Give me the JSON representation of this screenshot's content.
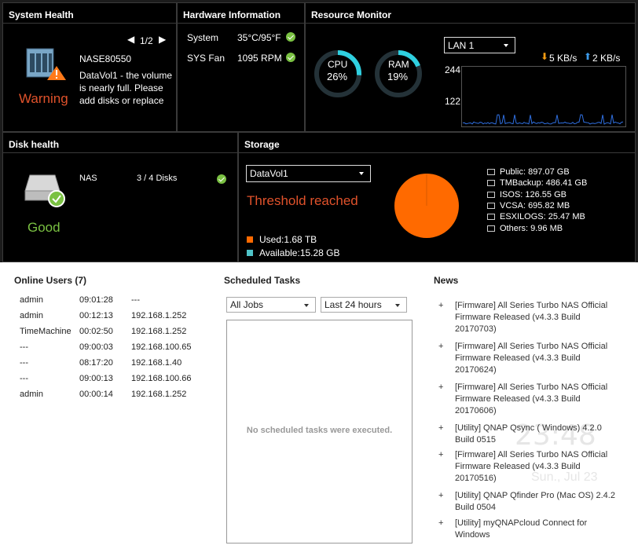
{
  "system_health": {
    "title": "System Health",
    "pager": "1/2",
    "device_name": "NASE80550",
    "status": "Warning",
    "message": "DataVol1 - the volume is nearly full. Please add disks or replace",
    "status_color": "#e0522b"
  },
  "hardware": {
    "title": "Hardware Information",
    "items": [
      {
        "label": "System",
        "value": "35°C/95°F"
      },
      {
        "label": "SYS Fan",
        "value": "1095 RPM"
      }
    ]
  },
  "resource": {
    "title": "Resource Monitor",
    "cpu_label": "CPU",
    "cpu_value": "26%",
    "cpu_fraction": 0.26,
    "ram_label": "RAM",
    "ram_value": "19%",
    "ram_fraction": 0.19,
    "lan_select": "LAN 1",
    "down_rate": "5 KB/s",
    "up_rate": "2 KB/s",
    "y_ticks": [
      "244",
      "122"
    ]
  },
  "disk_health": {
    "title": "Disk health",
    "device": "NAS",
    "disks": "3 / 4 Disks",
    "status": "Good",
    "status_color": "#7ac142"
  },
  "storage": {
    "title": "Storage",
    "volume_select": "DataVol1",
    "status": "Threshold reached",
    "used_label": "Used:1.68 TB",
    "available_label": "Available:15.28 GB",
    "used_color": "#ff6a00",
    "available_color": "#4fc3c8",
    "folders": [
      "Public: 897.07 GB",
      "TMBackup: 486.41 GB",
      "ISOS: 126.55 GB",
      "VCSA: 695.82 MB",
      "ESXILOGS: 25.47 MB",
      "Others: 9.96 MB"
    ]
  },
  "online_users": {
    "title": "Online Users (7)",
    "rows": [
      {
        "user": "admin",
        "time": "09:01:28",
        "ip": "---"
      },
      {
        "user": "admin",
        "time": "00:12:13",
        "ip": "192.168.1.252"
      },
      {
        "user": "TimeMachine",
        "time": "00:02:50",
        "ip": "192.168.1.252"
      },
      {
        "user": "---",
        "time": "09:00:03",
        "ip": "192.168.100.65"
      },
      {
        "user": "---",
        "time": "08:17:20",
        "ip": "192.168.1.40"
      },
      {
        "user": "---",
        "time": "09:00:13",
        "ip": "192.168.100.66"
      },
      {
        "user": "admin",
        "time": "00:00:14",
        "ip": "192.168.1.252"
      }
    ]
  },
  "scheduled": {
    "title": "Scheduled Tasks",
    "jobs_select": "All Jobs",
    "range_select": "Last 24 hours",
    "empty": "No scheduled tasks were executed."
  },
  "news": {
    "title": "News",
    "items": [
      {
        "l1": "[Firmware] All Series Turbo NAS Official",
        "l2": "Firmware Released (v4.3.3 Build",
        "l3": "20170703)"
      },
      {
        "l1": "[Firmware] All Series Turbo NAS Official",
        "l2": "Firmware Released (v4.3.3 Build",
        "l3": "20170624)"
      },
      {
        "l1": "[Firmware] All Series Turbo NAS Official",
        "l2": "Firmware Released (v4.3.3 Build",
        "l3": "20170606)"
      },
      {
        "l1": "[Utility] QNAP Qsync ( Windows) 4.2.0",
        "l2": "Build 0515",
        "l3": ""
      },
      {
        "l1": "[Firmware] All Series Turbo NAS Official",
        "l2": "Firmware Released (v4.3.3 Build",
        "l3": "20170516)"
      },
      {
        "l1": "[Utility] QNAP Qfinder Pro (Mac OS) 2.4.2",
        "l2": "Build 0504",
        "l3": ""
      },
      {
        "l1": "[Utility] myQNAPcloud Connect for",
        "l2": "Windows",
        "l3": ""
      }
    ]
  },
  "watermark": {
    "time": "23:48",
    "date": "Sun., Jul 23"
  }
}
